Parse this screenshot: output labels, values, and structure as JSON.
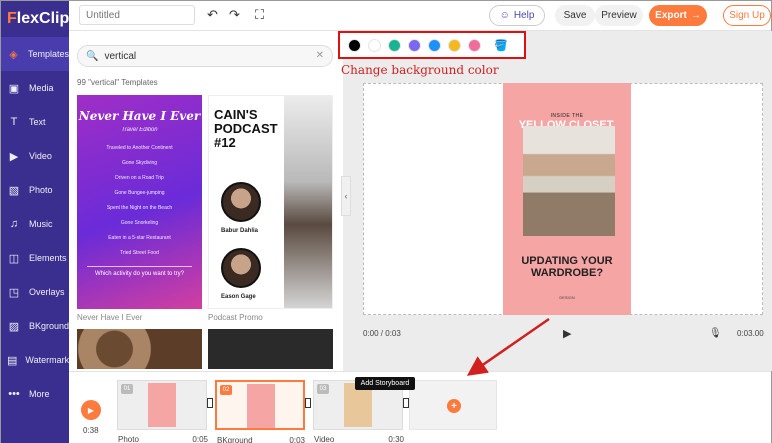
{
  "brand": {
    "logo_f": "F",
    "logo_rest": "lexClip"
  },
  "sidebar": {
    "items": [
      {
        "label": "Templates",
        "icon": "layers-icon",
        "glyph": "◈",
        "active": true
      },
      {
        "label": "Media",
        "icon": "media-icon",
        "glyph": "▣"
      },
      {
        "label": "Text",
        "icon": "text-icon",
        "glyph": "T"
      },
      {
        "label": "Video",
        "icon": "video-icon",
        "glyph": "▶"
      },
      {
        "label": "Photo",
        "icon": "photo-icon",
        "glyph": "▧"
      },
      {
        "label": "Music",
        "icon": "music-icon",
        "glyph": "♫"
      },
      {
        "label": "Elements",
        "icon": "elements-icon",
        "glyph": "◫"
      },
      {
        "label": "Overlays",
        "icon": "overlays-icon",
        "glyph": "◳"
      },
      {
        "label": "BKground",
        "icon": "background-icon",
        "glyph": "▨"
      },
      {
        "label": "Watermark",
        "icon": "watermark-icon",
        "glyph": "▤"
      },
      {
        "label": "More",
        "icon": "more-icon",
        "glyph": "•••"
      }
    ]
  },
  "topbar": {
    "title_placeholder": "Untitled",
    "help": "Help",
    "save": "Save",
    "preview": "Preview",
    "export": "Export",
    "signup": "Sign Up"
  },
  "search": {
    "value": "vertical",
    "count": "99 \"vertical\" Templates"
  },
  "templates": [
    {
      "name": "Never Have I Ever",
      "heading": "Never Have I Ever",
      "subtitle": "Travel Edition",
      "lines": [
        "Traveled to Another Continent",
        "Gone Skydiving",
        "Driven on a Road Trip",
        "Gone Bungee-jumping",
        "Spent the Night on the Beach",
        "Gone Snorkeling",
        "Eaten in a 5-star Restaurant",
        "Tried Street Food"
      ],
      "question": "Which activity do you want to try?"
    },
    {
      "name": "Podcast Promo",
      "heading": "CAIN'S PODCAST #12",
      "host1": "Babur Dahlia",
      "host2": "Eason Gage"
    }
  ],
  "preview": {
    "top_text": "INSIDE THE",
    "title": "YELLOW CLOSET.",
    "headline": "UPDATING YOUR WARDROBE?",
    "brand": "DESIGN",
    "time_current": "0:00 / 0:03",
    "time_total": "0:03.00"
  },
  "color_bar": {
    "swatches": [
      "#000000",
      "#ffffff",
      "#1ab394",
      "#7b68ee",
      "#1e90ff",
      "#f5b820",
      "#f06d9b"
    ],
    "annotation": "Change background color"
  },
  "storyboard": {
    "total": "0:38",
    "clips": [
      {
        "num": "01",
        "name": "Photo",
        "duration": "0:05",
        "thumb": "#f5a5a3"
      },
      {
        "num": "02",
        "name": "BKground",
        "duration": "0:03",
        "thumb": "#f5a5a3",
        "active": true
      },
      {
        "num": "03",
        "name": "Video",
        "duration": "0:30",
        "thumb": "#e8c89a"
      }
    ],
    "add_tooltip": "Add Storyboard",
    "add_symbol": "+"
  },
  "colors": {
    "accent": "#ff7a3d",
    "sidebar": "#3a2f8f",
    "annotation": "#d12020"
  }
}
